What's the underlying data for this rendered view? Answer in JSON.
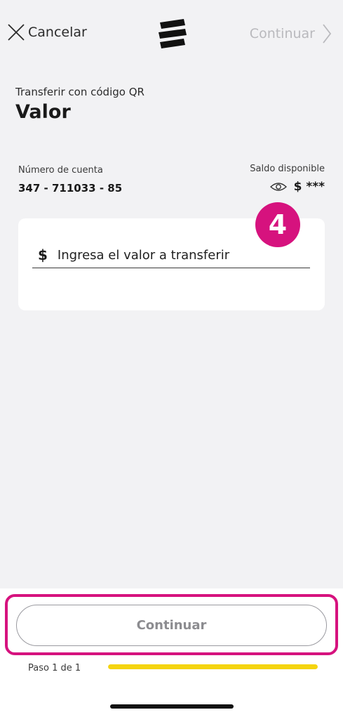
{
  "header": {
    "cancel_label": "Cancelar",
    "continue_label": "Continuar",
    "logo_icon": "bank-logo-icon"
  },
  "page": {
    "subtitle": "Transferir con código QR",
    "title": "Valor"
  },
  "account": {
    "label": "Número de cuenta",
    "number": "347 - 711033 - 85"
  },
  "balance": {
    "label": "Saldo disponible",
    "value": "$ ***",
    "visibility_icon": "eye-icon"
  },
  "step_badge": {
    "number": "4"
  },
  "amount": {
    "currency_symbol": "$",
    "placeholder": "Ingresa el valor a transferir",
    "value": ""
  },
  "footer": {
    "continue_label": "Continuar",
    "step_text": "Paso 1 de 1",
    "progress": 1.0
  },
  "colors": {
    "accent": "#d6127e",
    "progress": "#f5d40f",
    "background": "#f2f2f4",
    "disabled_text": "#b9b9bd"
  }
}
